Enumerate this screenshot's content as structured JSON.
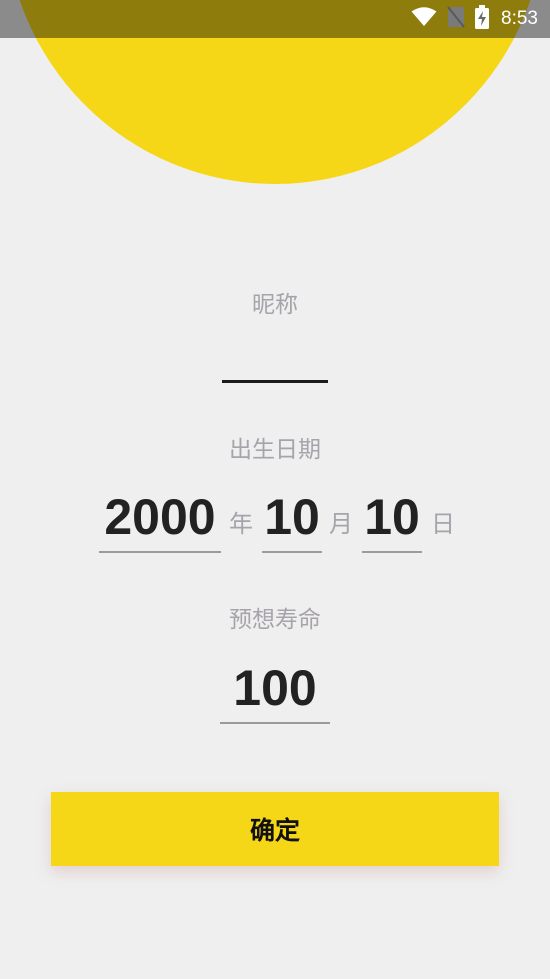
{
  "status_bar": {
    "time": "8:53",
    "icons": [
      "wifi-icon",
      "no-sim-icon",
      "battery-charging-icon"
    ]
  },
  "form": {
    "nickname_label": "昵称",
    "nickname_value": "",
    "birthdate_label": "出生日期",
    "year_value": "2000",
    "year_unit": "年",
    "month_value": "10",
    "month_unit": "月",
    "day_value": "10",
    "day_unit": "日",
    "lifespan_label": "预想寿命",
    "lifespan_value": "100"
  },
  "confirm_button": {
    "label": "确定"
  },
  "colors": {
    "accent": "#f5d718",
    "background": "#efefef",
    "label_gray": "#a7a3aa",
    "value_text": "#222222"
  }
}
